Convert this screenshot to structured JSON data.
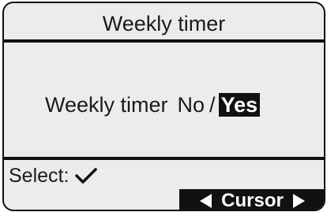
{
  "screen": {
    "title": "Weekly timer"
  },
  "setting": {
    "label": "Weekly timer",
    "option_no": "No",
    "separator": "/",
    "option_yes": "Yes",
    "selected": "Yes"
  },
  "footer": {
    "select_label": "Select:",
    "select_icon": "check-icon",
    "cursor_label": "Cursor",
    "cursor_left_icon": "triangle-left-icon",
    "cursor_right_icon": "triangle-right-icon"
  },
  "colors": {
    "background": "#ececec",
    "foreground": "#111111",
    "highlight_text": "#ffffff"
  }
}
